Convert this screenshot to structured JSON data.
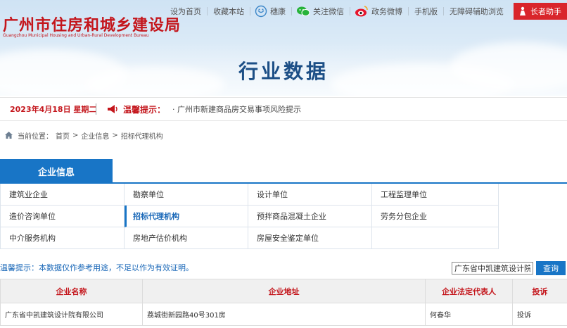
{
  "header": {
    "site_title": "广州市住房和城乡建设局",
    "site_title_en": "Guangzhou Municipal Housing and Urban-Rural Development Bureau",
    "page_heading": "行业数据",
    "top_links": {
      "set_home": "设为首页",
      "bookmark": "收藏本站",
      "sui_kang": "穗康",
      "wechat": "关注微信",
      "weibo": "政务微博",
      "mobile": "手机版",
      "accessibility": "无障碍辅助浏览",
      "elder_mode": "长者助手"
    },
    "colors": {
      "title_red": "#c4161c",
      "heading_blue": "#1c4f86",
      "elder_button": "#d9252b"
    }
  },
  "notice": {
    "date": "2023年4月18日 星期二",
    "label": "温馨提示：",
    "message": "·  广州市新建商品房交易事项风险提示"
  },
  "breadcrumb": {
    "prefix": "当前位置：",
    "items": [
      "首页",
      "企业信息",
      "招标代理机构"
    ],
    "separator": ">"
  },
  "category": {
    "tab_label": "企业信息",
    "accent": "#1875c6",
    "rows": [
      [
        "建筑业企业",
        "勘察单位",
        "设计单位",
        "工程监理单位"
      ],
      [
        "造价咨询单位",
        "招标代理机构",
        "预拌商品混凝土企业",
        "劳务分包企业"
      ],
      [
        "中介服务机构",
        "房地产估价机构",
        "房屋安全鉴定单位",
        ""
      ]
    ],
    "active": "招标代理机构"
  },
  "search": {
    "tip": "温馨提示：本数据仅作参考用途，不足以作为有效证明。",
    "input_value": "广东省中凯建筑设计院",
    "button_label": "查询"
  },
  "table": {
    "columns": [
      "企业名称",
      "企业地址",
      "企业法定代表人",
      "投诉"
    ],
    "rows": [
      [
        "广东省中凯建筑设计院有限公司",
        "荔城街新园路40号301房",
        "何春华",
        "投诉"
      ]
    ]
  }
}
